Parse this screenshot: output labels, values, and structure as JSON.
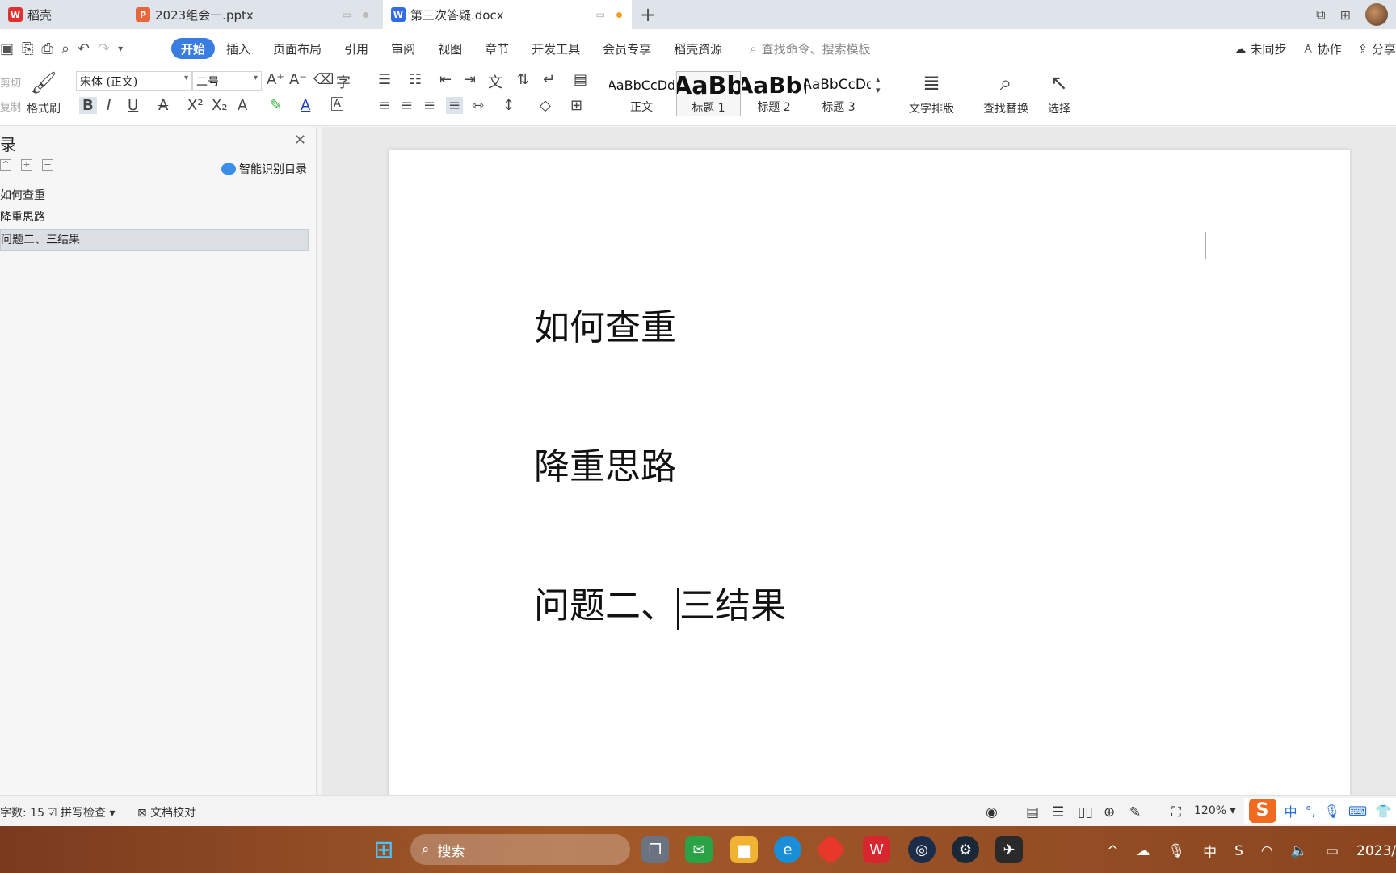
{
  "tabs": [
    {
      "label": "稻壳",
      "icon": "daoke-logo-icon",
      "color": "#e0312e"
    },
    {
      "label": "2023组会一.pptx",
      "icon": "ppt-file-icon",
      "color": "#e8673a"
    },
    {
      "label": "第三次答疑.docx",
      "icon": "word-file-icon",
      "color": "#2f6ce6"
    }
  ],
  "menu": {
    "items": [
      "开始",
      "插入",
      "页面布局",
      "引用",
      "审阅",
      "视图",
      "章节",
      "开发工具",
      "会员专享",
      "稻壳资源"
    ],
    "search_placeholder": "查找命令、搜索模板",
    "right": [
      "未同步",
      "协作",
      "分享"
    ]
  },
  "ribbon": {
    "cut": "剪切",
    "copy": "复制",
    "format_painter": "格式刷",
    "font_name": "宋体 (正文)",
    "font_size": "二号",
    "styles": [
      {
        "sample": "AaBbCcDd",
        "name": "正文"
      },
      {
        "sample": "AaBb",
        "name": "标题 1"
      },
      {
        "sample": "AaBb(",
        "name": "标题 2"
      },
      {
        "sample": "AaBbCcDd",
        "name": "标题 3"
      }
    ],
    "text_layout": "文字排版",
    "find_replace": "查找替换",
    "select": "选择"
  },
  "nav": {
    "title": "录",
    "smart_label": "智能识别目录",
    "items": [
      "如何查重",
      "降重思路",
      "问题二、三结果"
    ],
    "selected_index": 2
  },
  "document": {
    "headings": [
      "如何查重",
      "降重思路"
    ],
    "h3_before": "问题二、",
    "h3_after": "三结果"
  },
  "status": {
    "word_count": "字数: 15",
    "spell_check": "拼写检查",
    "proofread": "文档校对",
    "zoom": "120%"
  },
  "ime": {
    "mode": "中",
    "punct": "°,"
  },
  "taskbar": {
    "search_label": "搜索",
    "tray_lang": "中",
    "date": "2023/"
  }
}
